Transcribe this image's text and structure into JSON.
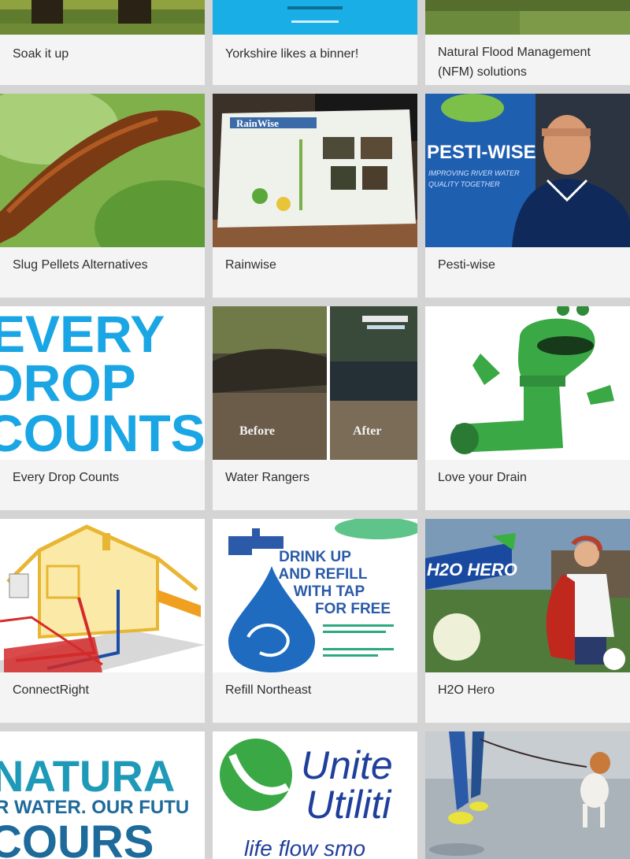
{
  "cards": [
    {
      "title": "Soak it up",
      "image": "garden-boots-photo"
    },
    {
      "title": "Yorkshire likes a binner!",
      "image": "blue-banner-graphic"
    },
    {
      "title": "Natural Flood Management (NFM) solutions",
      "image": "hillside-grass-photo"
    },
    {
      "title": "Slug Pellets Alternatives",
      "image": "slug-on-leaf-photo"
    },
    {
      "title": "Rainwise",
      "image": "rainwise-information-board-photo",
      "image_text": "RainWise"
    },
    {
      "title": "Pesti-wise",
      "image": "pesti-wise-banner-man-photo",
      "image_text": [
        "PESTI-WISE",
        "IMPROVING RIVER WATER",
        "QUALITY TOGETHER"
      ]
    },
    {
      "title": "Every Drop Counts",
      "image": "every-drop-counts-graphic",
      "image_text": [
        "EVERY",
        "DROP",
        "COUNTS"
      ]
    },
    {
      "title": "Water Rangers",
      "image": "before-after-stream-photo",
      "image_text": [
        "Before",
        "After"
      ]
    },
    {
      "title": "Love your Drain",
      "image": "green-pipe-mascot-graphic"
    },
    {
      "title": "ConnectRight",
      "image": "house-plumbing-diagram"
    },
    {
      "title": "Refill Northeast",
      "image": "refill-tap-poster",
      "image_text": [
        "DRINK UP",
        "AND REFILL",
        "WITH TAP",
        "FOR FREE"
      ]
    },
    {
      "title": "H2O Hero",
      "image": "h2o-hero-girl-photo",
      "image_text": "H2O HERO"
    },
    {
      "title": "",
      "image": "natural-course-graphic",
      "image_text": [
        "NATURA",
        "R WATER. OUR FUTU",
        "COURS"
      ]
    },
    {
      "title": "",
      "image": "united-utilities-logo",
      "image_text": [
        "Unite",
        "Utiliti",
        "life flow smo"
      ]
    },
    {
      "title": "",
      "image": "dog-walk-puddle-photo"
    }
  ],
  "colors": {
    "page_background": "#d4d4d4",
    "card_background": "#f4f4f4",
    "caption_text": "#2e2e2e",
    "brand_blue": "#1aa6e4",
    "brand_green": "#3aa845"
  }
}
